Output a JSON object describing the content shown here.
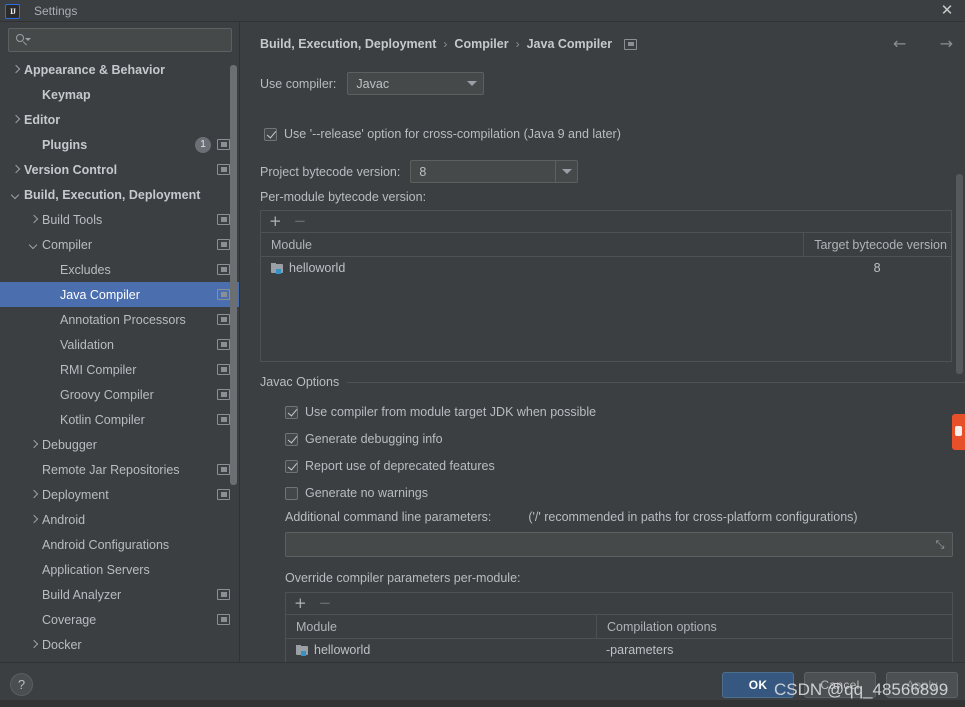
{
  "window": {
    "title": "Settings",
    "app_icon": "intellij-idea-icon",
    "close_icon": "close-icon"
  },
  "search": {
    "placeholder": "",
    "value": "",
    "icon": "search-icon"
  },
  "sidebar": {
    "items": [
      {
        "label": "Appearance & Behavior",
        "arrow": "right",
        "indent": 0,
        "bold": true,
        "badge": false,
        "count": null,
        "selected": false
      },
      {
        "label": "Keymap",
        "arrow": "none",
        "indent": 1,
        "bold": true,
        "badge": false,
        "count": null,
        "selected": false
      },
      {
        "label": "Editor",
        "arrow": "right",
        "indent": 0,
        "bold": true,
        "badge": false,
        "count": null,
        "selected": false
      },
      {
        "label": "Plugins",
        "arrow": "none",
        "indent": 1,
        "bold": true,
        "badge": true,
        "count": "1",
        "selected": false
      },
      {
        "label": "Version Control",
        "arrow": "right",
        "indent": 0,
        "bold": true,
        "badge": true,
        "count": null,
        "selected": false
      },
      {
        "label": "Build, Execution, Deployment",
        "arrow": "down",
        "indent": 0,
        "bold": true,
        "badge": false,
        "count": null,
        "selected": false
      },
      {
        "label": "Build Tools",
        "arrow": "right",
        "indent": 1,
        "bold": false,
        "badge": true,
        "count": null,
        "selected": false
      },
      {
        "label": "Compiler",
        "arrow": "down",
        "indent": 1,
        "bold": false,
        "badge": true,
        "count": null,
        "selected": false
      },
      {
        "label": "Excludes",
        "arrow": "none",
        "indent": 2,
        "bold": false,
        "badge": true,
        "count": null,
        "selected": false
      },
      {
        "label": "Java Compiler",
        "arrow": "none",
        "indent": 2,
        "bold": false,
        "badge": true,
        "count": null,
        "selected": true
      },
      {
        "label": "Annotation Processors",
        "arrow": "none",
        "indent": 2,
        "bold": false,
        "badge": true,
        "count": null,
        "selected": false
      },
      {
        "label": "Validation",
        "arrow": "none",
        "indent": 2,
        "bold": false,
        "badge": true,
        "count": null,
        "selected": false
      },
      {
        "label": "RMI Compiler",
        "arrow": "none",
        "indent": 2,
        "bold": false,
        "badge": true,
        "count": null,
        "selected": false
      },
      {
        "label": "Groovy Compiler",
        "arrow": "none",
        "indent": 2,
        "bold": false,
        "badge": true,
        "count": null,
        "selected": false
      },
      {
        "label": "Kotlin Compiler",
        "arrow": "none",
        "indent": 2,
        "bold": false,
        "badge": true,
        "count": null,
        "selected": false
      },
      {
        "label": "Debugger",
        "arrow": "right",
        "indent": 1,
        "bold": false,
        "badge": false,
        "count": null,
        "selected": false
      },
      {
        "label": "Remote Jar Repositories",
        "arrow": "none",
        "indent": 1,
        "bold": false,
        "badge": true,
        "count": null,
        "selected": false
      },
      {
        "label": "Deployment",
        "arrow": "right",
        "indent": 1,
        "bold": false,
        "badge": true,
        "count": null,
        "selected": false
      },
      {
        "label": "Android",
        "arrow": "right",
        "indent": 1,
        "bold": false,
        "badge": false,
        "count": null,
        "selected": false
      },
      {
        "label": "Android Configurations",
        "arrow": "none",
        "indent": 1,
        "bold": false,
        "badge": false,
        "count": null,
        "selected": false
      },
      {
        "label": "Application Servers",
        "arrow": "none",
        "indent": 1,
        "bold": false,
        "badge": false,
        "count": null,
        "selected": false
      },
      {
        "label": "Build Analyzer",
        "arrow": "none",
        "indent": 1,
        "bold": false,
        "badge": true,
        "count": null,
        "selected": false
      },
      {
        "label": "Coverage",
        "arrow": "none",
        "indent": 1,
        "bold": false,
        "badge": true,
        "count": null,
        "selected": false
      },
      {
        "label": "Docker",
        "arrow": "right",
        "indent": 1,
        "bold": false,
        "badge": false,
        "count": null,
        "selected": false
      }
    ]
  },
  "main": {
    "breadcrumb": [
      "Build, Execution, Deployment",
      "Compiler",
      "Java Compiler"
    ],
    "breadcrumb_sep": "›",
    "nav_back_icon": "←",
    "nav_forward_icon": "→",
    "use_compiler_label": "Use compiler:",
    "use_compiler_value": "Javac",
    "release_option_label": "Use '--release' option for cross-compilation (Java 9 and later)",
    "release_option_checked": true,
    "project_bytecode_label": "Project bytecode version:",
    "project_bytecode_value": "8",
    "per_module_label": "Per-module bytecode version:",
    "add_icon": "+",
    "remove_icon": "−",
    "bytecode_table": {
      "columns": [
        "Module",
        "Target bytecode version"
      ],
      "rows": [
        {
          "module": "helloworld",
          "version": "8"
        }
      ]
    },
    "javac_options_title": "Javac Options",
    "javac_checkboxes": [
      {
        "label": "Use compiler from module target JDK when possible",
        "checked": true
      },
      {
        "label": "Generate debugging info",
        "checked": true
      },
      {
        "label": "Report use of deprecated features",
        "checked": true
      },
      {
        "label": "Generate no warnings",
        "checked": false
      }
    ],
    "additional_params_label": "Additional command line parameters:",
    "additional_params_hint": "('/' recommended in paths for cross-platform configurations)",
    "additional_params_value": "",
    "expand_icon": "⤡",
    "override_label": "Override compiler parameters per-module:",
    "override_table": {
      "columns": [
        "Module",
        "Compilation options"
      ],
      "rows": [
        {
          "module": "helloworld",
          "options": "-parameters"
        }
      ]
    }
  },
  "footer": {
    "help_label": "?",
    "ok_label": "OK",
    "cancel_label": "Cancel",
    "apply_label": "Apply"
  },
  "watermark": {
    "text": "CSDN @qq_48566899"
  },
  "colors": {
    "background": "#3c3f41",
    "selection": "#4b6eaf",
    "primary_button": "#365880",
    "accent_blue": "#3592c4",
    "accent_orange": "#e8502a",
    "text": "#bbbbbb"
  }
}
